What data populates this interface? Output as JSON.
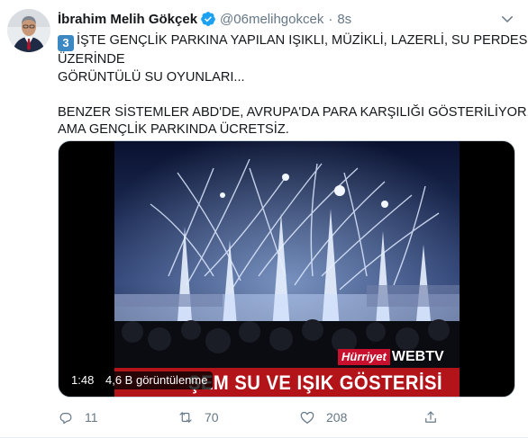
{
  "tweet": {
    "display_name": "İbrahim Melih Gökçek",
    "handle": "@06melihgokcek",
    "separator": "·",
    "time": "8s",
    "keycap": "3",
    "lines": [
      "İŞTE GENÇLİK PARKINA YAPILAN IŞIKLI, MÜZİKLİ, LAZERLİ, SU PERDESİ",
      "ÜZERİNDE",
      "GÖRÜNTÜLÜ SU OYUNLARI...",
      "",
      "BENZER SİSTEMLER ABD'DE, AVRUPA'DA PARA KARŞILIĞI GÖSTERİLİYOR.",
      "AMA GENÇLİK PARKINDA ÜCRETSİZ."
    ]
  },
  "video": {
    "duration": "1:48",
    "views": "4,6 B görüntülenme",
    "caption": "ŞEM SU VE IŞIK GÖSTERİSİ",
    "brand_left": "Hürriyet",
    "brand_right": "WEBTV"
  },
  "actions": {
    "reply_count": "11",
    "retweet_count": "70",
    "like_count": "208"
  },
  "colors": {
    "verified": "#1da1f2",
    "muted": "#657786",
    "caption_bar": "#b3141a"
  },
  "icons": [
    "verified-badge-icon",
    "chevron-down-icon",
    "reply-icon",
    "retweet-icon",
    "like-icon",
    "share-icon"
  ]
}
